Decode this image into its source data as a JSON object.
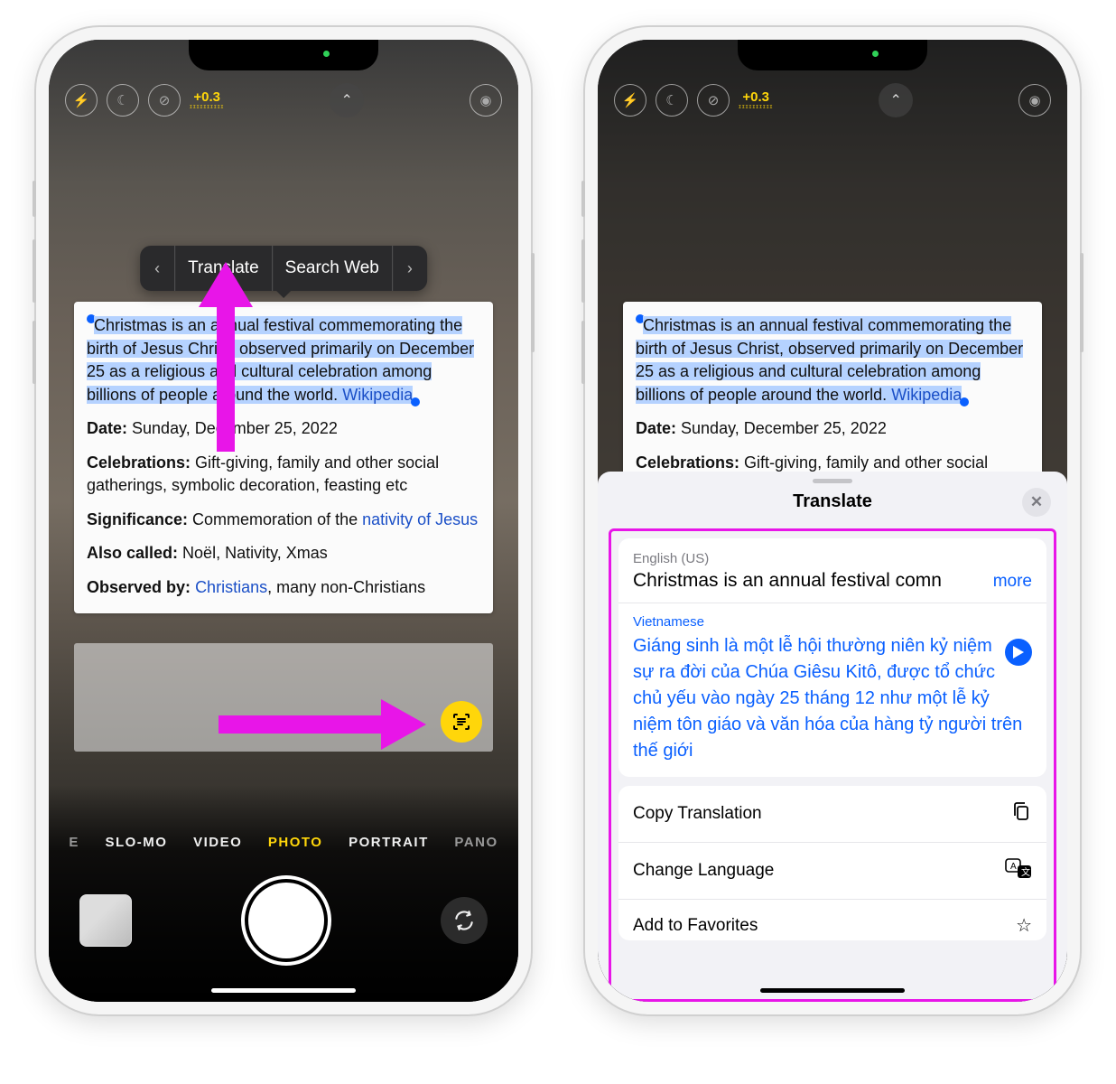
{
  "camera": {
    "exposure": "+0.3",
    "modes": {
      "left_cut": "E",
      "slomo": "SLO-MO",
      "video": "VIDEO",
      "photo": "PHOTO",
      "portrait": "PORTRAIT",
      "pano_cut": "PANO"
    }
  },
  "context_menu": {
    "translate": "Translate",
    "search_web": "Search Web"
  },
  "selected_text": {
    "para": "Christmas is an annual festival commemorating the birth of Jesus Christ, observed primarily on December 25 as a religious and cultural celebration among billions of people around the world.",
    "wiki": "Wikipedia",
    "date_label": "Date:",
    "date_value": "Sunday, December 25, 2022",
    "celebrations_label": "Celebrations:",
    "celebrations_value": "Gift-giving, family and other social gatherings, symbolic decoration, feasting etc",
    "significance_label": "Significance:",
    "significance_value_prefix": "Commemoration of the ",
    "significance_link": "nativity of Jesus",
    "also_label": "Also called:",
    "also_value": "Noël, Nativity, Xmas",
    "observed_label": "Observed by:",
    "observed_link": "Christians",
    "observed_suffix": ", many non-Christians"
  },
  "translate_sheet": {
    "title": "Translate",
    "source_lang": "English (US)",
    "source_text": "Christmas is an annual festival comn",
    "more": "more",
    "target_lang": "Vietnamese",
    "target_text": "Giáng sinh là một lễ hội thường niên kỷ niệm sự ra đời của Chúa Giêsu Kitô, được tổ chức chủ yếu vào ngày 25 tháng 12 như một lễ kỷ niệm tôn giáo và văn hóa của hàng tỷ người trên thế giới",
    "actions": {
      "copy": "Copy Translation",
      "change": "Change Language",
      "fav": "Add to Favorites"
    }
  }
}
